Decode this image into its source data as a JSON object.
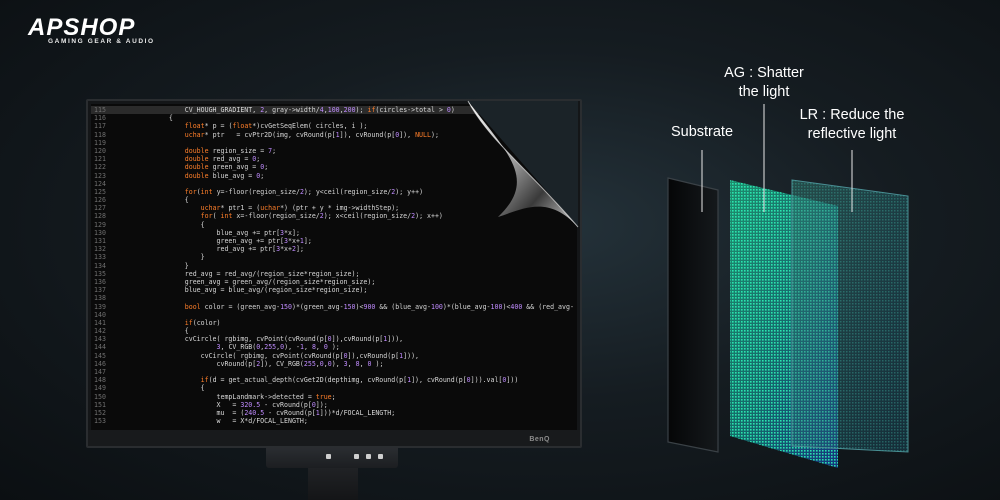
{
  "logo": {
    "wordmark": "APSHOP",
    "tagline": "GAMING GEAR & AUDIO"
  },
  "monitor": {
    "brand": "BenQ"
  },
  "code": {
    "lines": [
      {
        "n": "115",
        "text": "        CV_HOUGH_GRADIENT, 2, gray->width/4,100,200); if(circles->total > 0)",
        "hl": true
      },
      {
        "n": "116",
        "text": "    {"
      },
      {
        "n": "117",
        "text": "        float* p = (float*)cvGetSeqElem( circles, i );"
      },
      {
        "n": "118",
        "text": "        uchar* ptr   = cvPtr2D(img, cvRound(p[1]), cvRound(p[0]), NULL);"
      },
      {
        "n": "119",
        "text": ""
      },
      {
        "n": "120",
        "text": "        double region_size = 7;"
      },
      {
        "n": "121",
        "text": "        double red_avg = 0;"
      },
      {
        "n": "122",
        "text": "        double green_avg = 0;"
      },
      {
        "n": "123",
        "text": "        double blue_avg = 0;"
      },
      {
        "n": "124",
        "text": ""
      },
      {
        "n": "125",
        "text": "        for(int y=-floor(region_size/2); y<ceil(region_size/2); y++)"
      },
      {
        "n": "126",
        "text": "        {"
      },
      {
        "n": "127",
        "text": "            uchar* ptr1 = (uchar*) (ptr + y * img->widthStep);"
      },
      {
        "n": "128",
        "text": "            for( int x=-floor(region_size/2); x<ceil(region_size/2); x++)"
      },
      {
        "n": "129",
        "text": "            {"
      },
      {
        "n": "130",
        "text": "                blue_avg += ptr[3*x];"
      },
      {
        "n": "131",
        "text": "                green_avg += ptr[3*x+1];"
      },
      {
        "n": "132",
        "text": "                red_avg += ptr[3*x+2];"
      },
      {
        "n": "133",
        "text": "            }"
      },
      {
        "n": "134",
        "text": "        }"
      },
      {
        "n": "135",
        "text": "        red_avg = red_avg/(region_size*region_size);"
      },
      {
        "n": "136",
        "text": "        green_avg = green_avg/(region_size*region_size);"
      },
      {
        "n": "137",
        "text": "        blue_avg = blue_avg/(region_size*region_size);"
      },
      {
        "n": "138",
        "text": ""
      },
      {
        "n": "139",
        "text": "        bool color = (green_avg-150)*(green_avg-150)<900 && (blue_avg-100)*(blue_avg-100)<400 && (red_avg-"
      },
      {
        "n": "140",
        "text": ""
      },
      {
        "n": "141",
        "text": "        if(color)"
      },
      {
        "n": "142",
        "text": "        {"
      },
      {
        "n": "143",
        "text": "        cvCircle( rgbimg, cvPoint(cvRound(p[0]),cvRound(p[1])),"
      },
      {
        "n": "144",
        "text": "                3, CV_RGB(0,255,0), -1, 8, 0 );"
      },
      {
        "n": "145",
        "text": "            cvCircle( rgbimg, cvPoint(cvRound(p[0]),cvRound(p[1])),"
      },
      {
        "n": "146",
        "text": "                cvRound(p[2]), CV_RGB(255,0,0), 3, 8, 0 );"
      },
      {
        "n": "147",
        "text": ""
      },
      {
        "n": "148",
        "text": "            if(d = get_actual_depth(cvGet2D(depthimg, cvRound(p[1]), cvRound(p[0])).val[0]))"
      },
      {
        "n": "149",
        "text": "            {"
      },
      {
        "n": "150",
        "text": "                tempLandmark->detected = true;"
      },
      {
        "n": "151",
        "text": "                X   = 320.5 - cvRound(p[0]);"
      },
      {
        "n": "152",
        "text": "                mu  = (240.5 - cvRound(p[1]))*d/FOCAL_LENGTH;"
      },
      {
        "n": "153",
        "text": "                w   = X*d/FOCAL_LENGTH;"
      }
    ]
  },
  "layers": {
    "ag_label": "AG : Shatter\nthe light",
    "substrate_label": "Substrate",
    "lr_label": "LR : Reduce the\nreflective light",
    "colors": {
      "substrate": "#0b0d0f",
      "ag": "#1fc89a",
      "lr": "#2a6e78"
    }
  }
}
